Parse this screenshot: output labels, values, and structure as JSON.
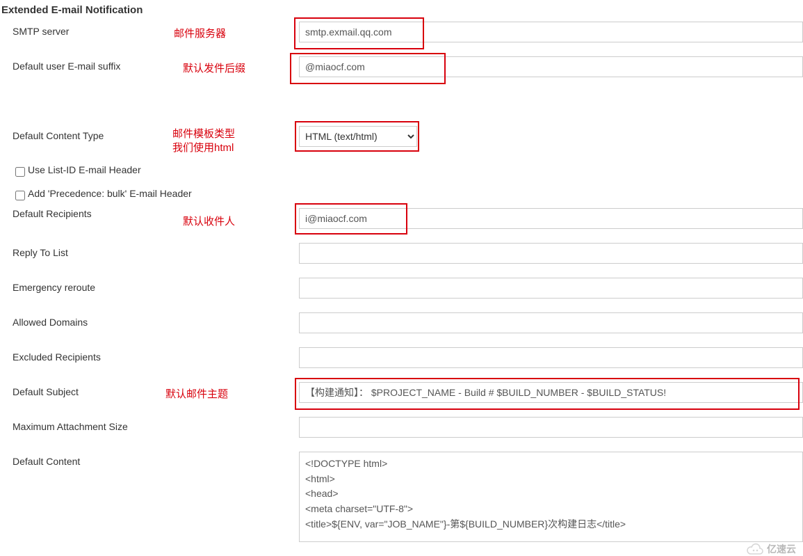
{
  "section_title": "Extended E-mail Notification",
  "annotations": {
    "smtp": "邮件服务器",
    "suffix": "默认发件后缀",
    "content_type_l1": "邮件模板类型",
    "content_type_l2": "我们使用html",
    "recipients": "默认收件人",
    "subject": "默认邮件主题"
  },
  "fields": {
    "smtp_server": {
      "label": "SMTP server",
      "value": "smtp.exmail.qq.com"
    },
    "email_suffix": {
      "label": "Default user E-mail suffix",
      "value": "@miaocf.com"
    },
    "content_type": {
      "label": "Default Content Type",
      "value": "HTML (text/html)"
    },
    "use_list_id": {
      "label": "Use List-ID E-mail Header",
      "checked": false
    },
    "precedence_bulk": {
      "label": "Add 'Precedence: bulk' E-mail Header",
      "checked": false
    },
    "default_recipients": {
      "label": "Default Recipients",
      "value": "i@miaocf.com"
    },
    "reply_to": {
      "label": "Reply To List",
      "value": ""
    },
    "emergency_reroute": {
      "label": "Emergency reroute",
      "value": ""
    },
    "allowed_domains": {
      "label": "Allowed Domains",
      "value": ""
    },
    "excluded_recipients": {
      "label": "Excluded Recipients",
      "value": ""
    },
    "default_subject": {
      "label": "Default Subject",
      "value": "【构建通知】： $PROJECT_NAME - Build # $BUILD_NUMBER - $BUILD_STATUS!"
    },
    "max_attachment": {
      "label": "Maximum Attachment Size",
      "value": ""
    },
    "default_content": {
      "label": "Default Content",
      "value": "<!DOCTYPE html>\n<html>\n<head>\n<meta charset=\"UTF-8\">\n<title>${ENV, var=\"JOB_NAME\"}-第${BUILD_NUMBER}次构建日志</title>"
    }
  },
  "watermark": "亿速云"
}
